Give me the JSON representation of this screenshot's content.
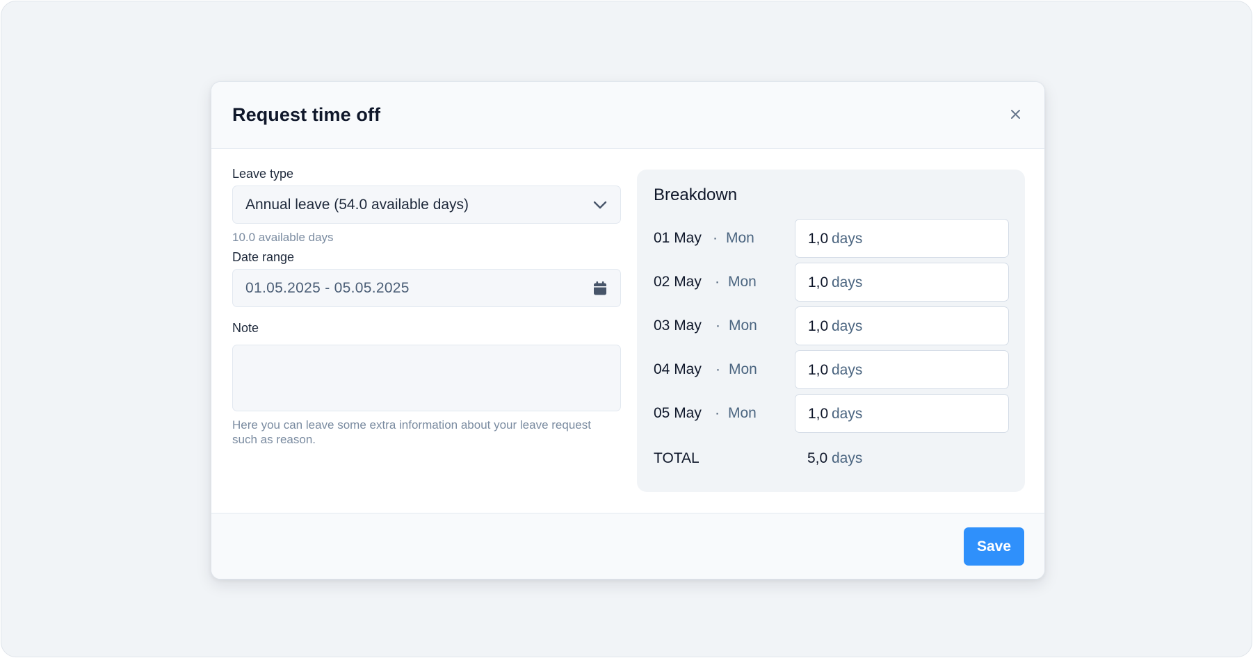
{
  "modal": {
    "title": "Request time off"
  },
  "form": {
    "leave_type": {
      "label": "Leave type",
      "value": "Annual leave (54.0 available days)",
      "helper": "10.0 available days"
    },
    "date_range": {
      "label": "Date range",
      "value": "01.05.2025 - 05.05.2025"
    },
    "note": {
      "label": "Note",
      "value": "",
      "helper": "Here you can leave some extra information about your leave request such as reason."
    }
  },
  "breakdown": {
    "title": "Breakdown",
    "separator": "·",
    "rows": [
      {
        "date": "01 May",
        "weekday": "Mon",
        "amount": "1,0",
        "unit": "days"
      },
      {
        "date": "02 May",
        "weekday": "Mon",
        "amount": "1,0",
        "unit": "days"
      },
      {
        "date": "03 May",
        "weekday": "Mon",
        "amount": "1,0",
        "unit": "days"
      },
      {
        "date": "04 May",
        "weekday": "Mon",
        "amount": "1,0",
        "unit": "days"
      },
      {
        "date": "05 May",
        "weekday": "Mon",
        "amount": "1,0",
        "unit": "days"
      }
    ],
    "total": {
      "label": "TOTAL",
      "amount": "5,0",
      "unit": "days"
    }
  },
  "footer": {
    "save_label": "Save"
  },
  "icons": {
    "close": "close-icon",
    "select": "chevron-down-icon",
    "date": "calendar-icon"
  },
  "colors": {
    "primary": "#2f90fb",
    "background": "#f1f4f7",
    "text": "#0f172a",
    "muted": "#4b6580"
  }
}
